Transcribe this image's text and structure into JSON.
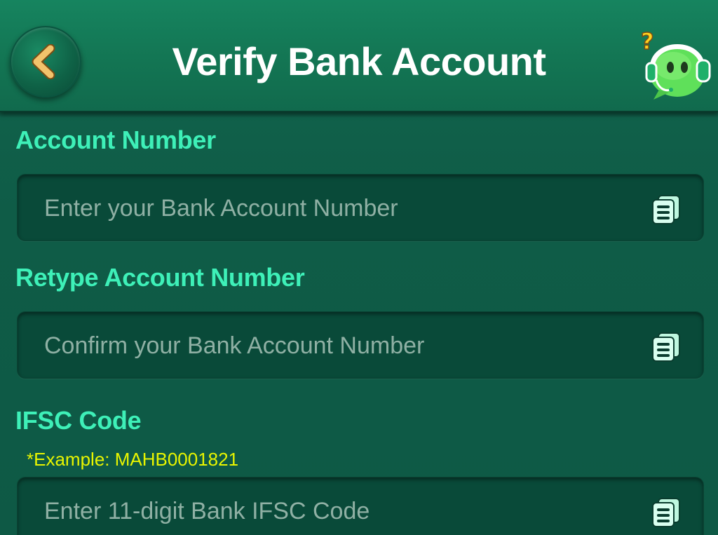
{
  "header": {
    "title": "Verify Bank Account",
    "back_icon": "chevron-left-icon",
    "support_icon": "customer-support-mascot-icon"
  },
  "form": {
    "account_number": {
      "label": "Account Number",
      "placeholder": "Enter your Bank Account Number",
      "value": "",
      "icon": "paste-icon"
    },
    "retype_account_number": {
      "label": "Retype Account Number",
      "placeholder": "Confirm your Bank Account Number",
      "value": "",
      "icon": "paste-icon"
    },
    "ifsc_code": {
      "label": "IFSC Code",
      "hint": "*Example: MAHB0001821",
      "placeholder": "Enter 11-digit Bank IFSC Code",
      "value": "",
      "icon": "paste-icon"
    }
  },
  "colors": {
    "background": "#0f5a45",
    "header": "#137553",
    "label": "#3ef0b8",
    "hint": "#e8f500",
    "input_bg": "#094a39",
    "placeholder": "#8fb0a4",
    "back_chevron": "#f2c36b",
    "mascot": "#5fe05a"
  }
}
